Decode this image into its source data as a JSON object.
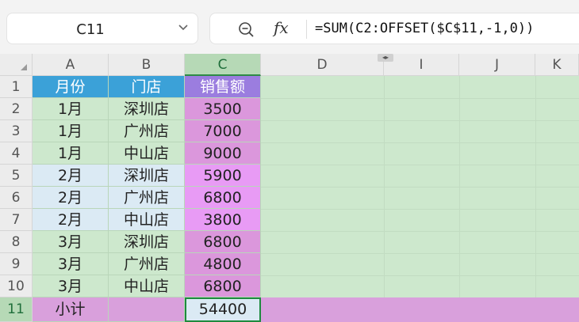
{
  "toolbar": {
    "name_box": "C11",
    "formula": "=SUM(C2:OFFSET($C$11,-1,0))",
    "fx_label": "fx"
  },
  "columns": [
    "A",
    "B",
    "C",
    "D",
    "I",
    "J",
    "K"
  ],
  "rows": [
    "1",
    "2",
    "3",
    "4",
    "5",
    "6",
    "7",
    "8",
    "9",
    "10",
    "11"
  ],
  "header": {
    "a": "月份",
    "b": "门店",
    "c": "销售额"
  },
  "data": [
    {
      "month": "1月",
      "store": "深圳店",
      "sales": "3500"
    },
    {
      "month": "1月",
      "store": "广州店",
      "sales": "7000"
    },
    {
      "month": "1月",
      "store": "中山店",
      "sales": "9000"
    },
    {
      "month": "2月",
      "store": "深圳店",
      "sales": "5900"
    },
    {
      "month": "2月",
      "store": "广州店",
      "sales": "6800"
    },
    {
      "month": "2月",
      "store": "中山店",
      "sales": "3800"
    },
    {
      "month": "3月",
      "store": "深圳店",
      "sales": "6800"
    },
    {
      "month": "3月",
      "store": "广州店",
      "sales": "4800"
    },
    {
      "month": "3月",
      "store": "中山店",
      "sales": "6800"
    }
  ],
  "subtotal": {
    "label": "小计",
    "value": "54400"
  },
  "colors": {
    "header_blue": "#3ba1d8",
    "header_purple": "#9b7ddf",
    "sales_pink": "#db97dc",
    "group2_light_blue": "#dbeaf4",
    "group2_sales": "#e89bf5",
    "subtotal_row": "#d9a0dc",
    "sheet_green": "#cde8cd",
    "active_border": "#1e8a3e"
  }
}
